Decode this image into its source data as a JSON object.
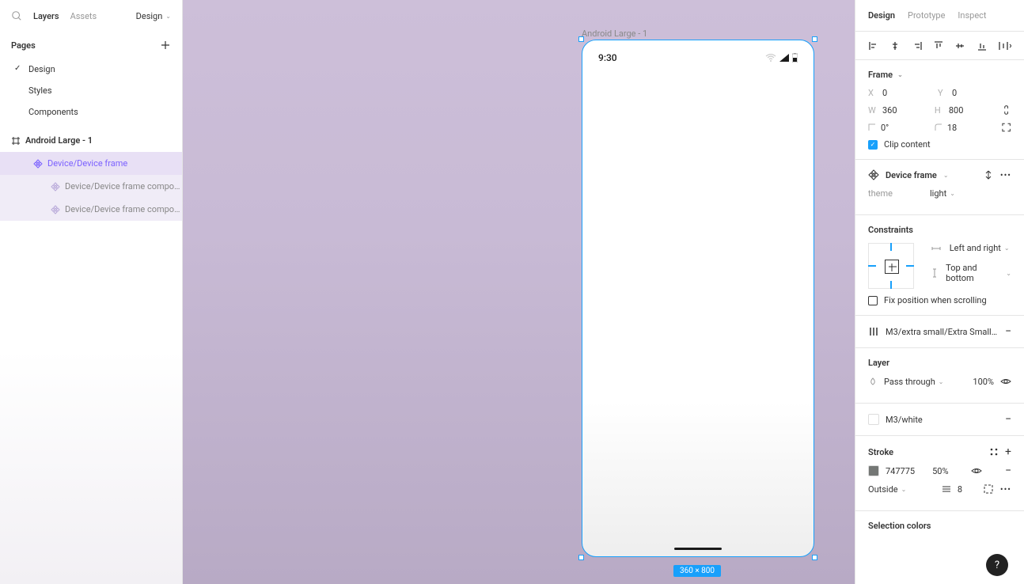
{
  "leftPanel": {
    "tabs": {
      "layers": "Layers",
      "assets": "Assets",
      "designDropdown": "Design"
    },
    "pagesHeader": "Pages",
    "pages": [
      "Design",
      "Styles",
      "Components"
    ],
    "layers": {
      "root": "Android Large - 1",
      "child1": "Device/Device frame",
      "child2": "Device/Device frame compo…",
      "child3": "Device/Device frame compo…"
    }
  },
  "canvas": {
    "frameLabel": "Android Large - 1",
    "statusTime": "9:30",
    "dimensions": "360 × 800"
  },
  "rightPanel": {
    "tabs": {
      "design": "Design",
      "prototype": "Prototype",
      "inspect": "Inspect"
    },
    "frame": {
      "title": "Frame",
      "x": "0",
      "y": "0",
      "w": "360",
      "h": "800",
      "rotation": "0°",
      "radius": "18",
      "clipContent": "Clip content"
    },
    "component": {
      "name": "Device frame",
      "themeLabel": "theme",
      "themeValue": "light"
    },
    "constraints": {
      "title": "Constraints",
      "horizontal": "Left and right",
      "vertical": "Top and bottom",
      "fixPosition": "Fix position when scrolling"
    },
    "gridStyle": "M3/extra small/Extra Small …",
    "layer": {
      "title": "Layer",
      "blend": "Pass through",
      "opacity": "100%",
      "fill": "M3/white"
    },
    "stroke": {
      "title": "Stroke",
      "color": "747775",
      "opacity": "50%",
      "position": "Outside",
      "weight": "8"
    },
    "selectionColors": "Selection colors"
  }
}
